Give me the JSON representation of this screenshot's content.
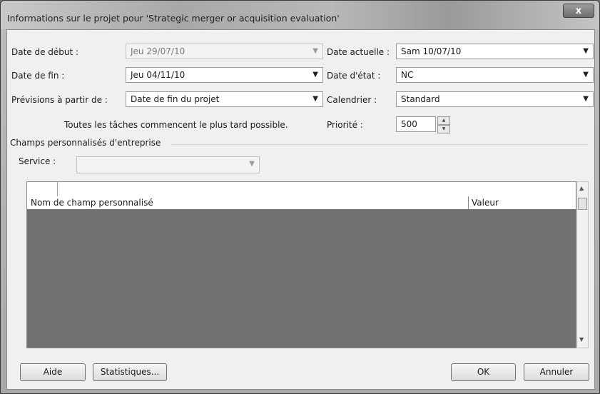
{
  "window": {
    "title": "Informations sur le projet pour 'Strategic merger or acquisition evaluation'",
    "close_glyph": "x"
  },
  "fields": {
    "start_date_label": "Date de début :",
    "start_date_value": "Jeu 29/07/10",
    "end_date_label": "Date de fin :",
    "end_date_value": "Jeu 04/11/10",
    "schedule_from_label": "Prévisions à partir de :",
    "schedule_from_value": "Date de fin du projet",
    "schedule_note": "Toutes les tâches commencent le plus tard possible.",
    "current_date_label": "Date actuelle :",
    "current_date_value": "Sam 10/07/10",
    "status_date_label": "Date d'état :",
    "status_date_value": "NC",
    "calendar_label": "Calendrier :",
    "calendar_value": "Standard",
    "priority_label": "Priorité :",
    "priority_value": "500"
  },
  "enterprise": {
    "group_label": "Champs personnalisés d'entreprise",
    "service_label": "Service :",
    "service_value": "",
    "columns": [
      "Nom de champ personnalisé",
      "Valeur"
    ]
  },
  "buttons": {
    "help": "Aide",
    "statistics": "Statistiques...",
    "ok": "OK",
    "cancel": "Annuler"
  },
  "icons": {
    "dropdown_arrow": "▼",
    "spin_up": "▲",
    "spin_down": "▼",
    "scroll_up": "▲",
    "scroll_down": "▼"
  }
}
